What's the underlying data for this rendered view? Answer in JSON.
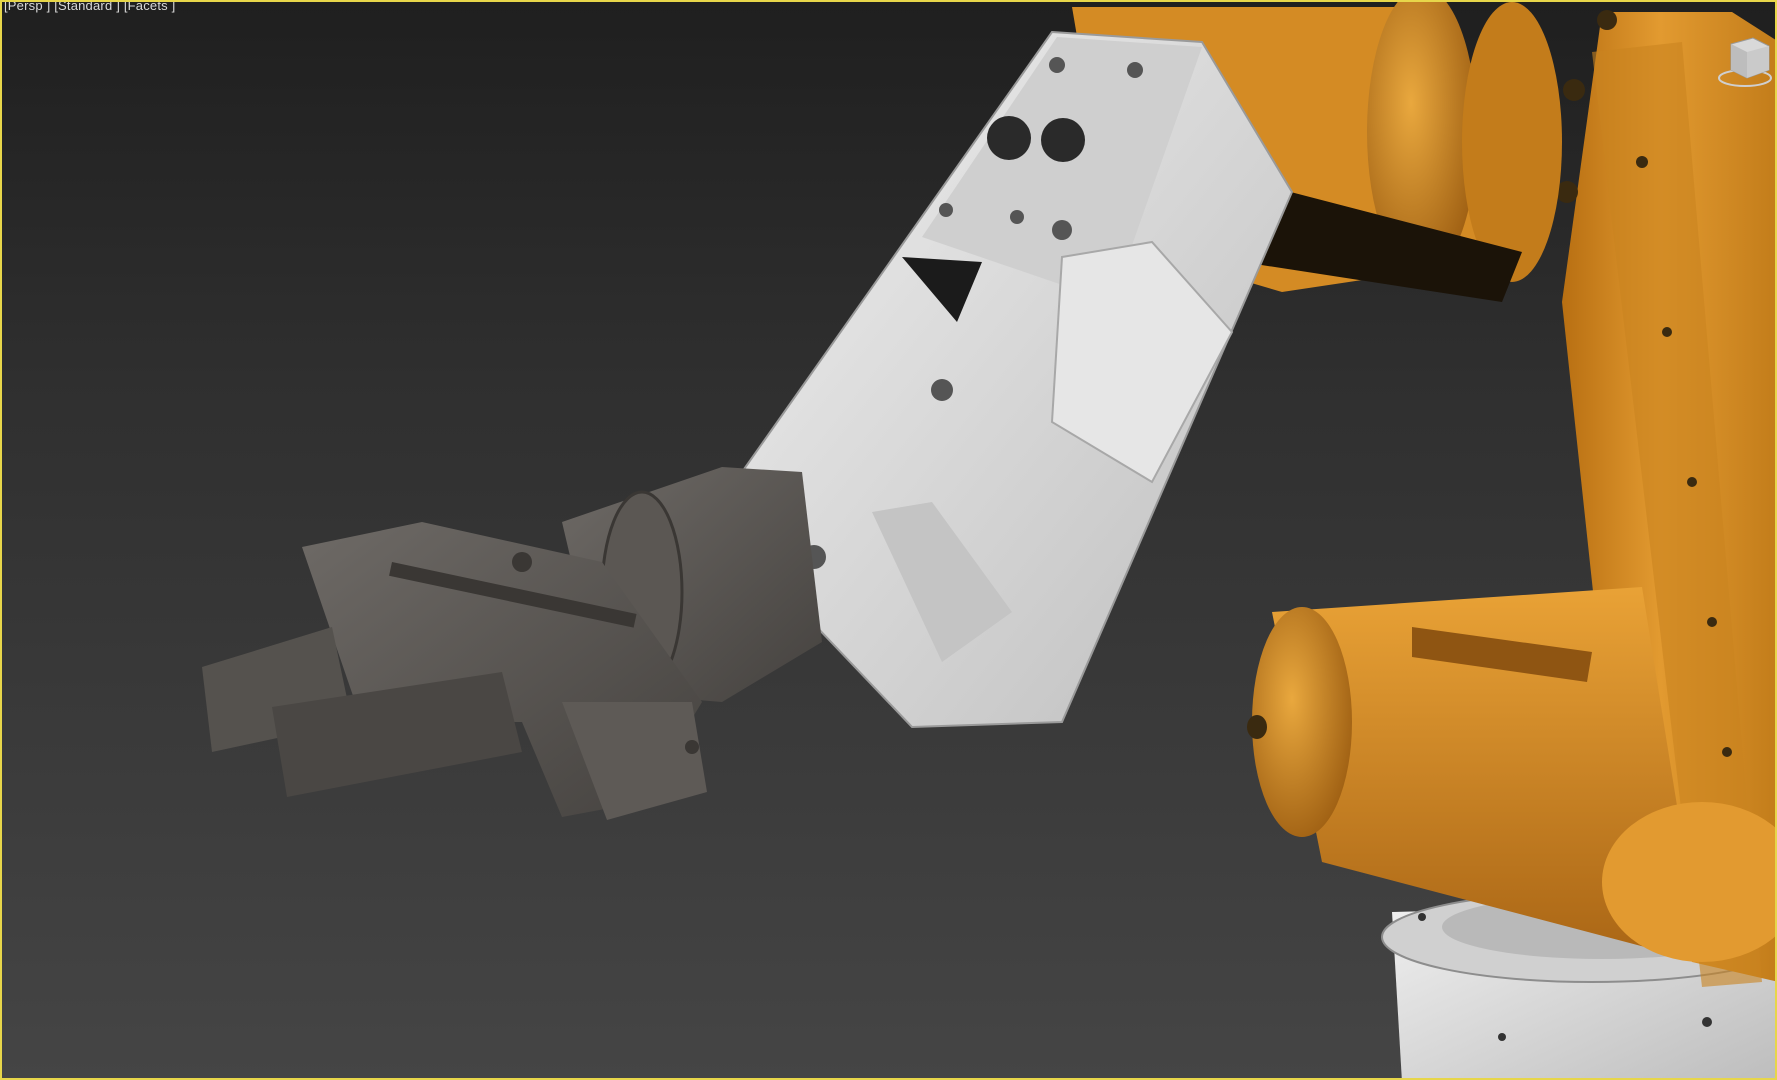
{
  "viewport": {
    "label": "[Persp ] [Standard ] [Facets ]",
    "active_border_color": "#e7d64a",
    "background_top": "#1f1f1f",
    "background_bottom": "#454545"
  },
  "scene": {
    "subject": "industrial robot arm with gripper",
    "colors": {
      "robot_orange": "#d78a22",
      "panel_white": "#d9d9d9",
      "gripper_gray": "#5a5653"
    }
  },
  "viewcube": {
    "icon": "viewcube-icon"
  }
}
